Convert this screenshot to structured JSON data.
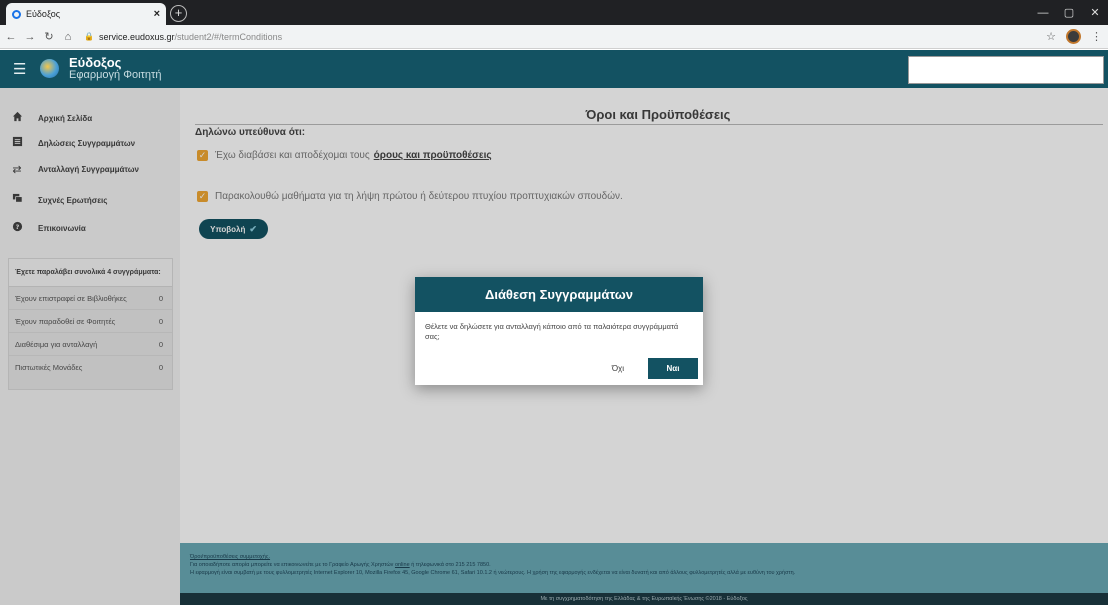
{
  "browser": {
    "tab_title": "Εύδοξος",
    "tab_close": "×",
    "new_tab": "+",
    "url_host": "service.eudoxus.gr",
    "url_path": "/student2/#/termConditions",
    "window_controls": [
      "—",
      "▢",
      "✕"
    ]
  },
  "header": {
    "title": "Εύδοξος",
    "subtitle": "Εφαρμογή Φοιτητή"
  },
  "sidebar": {
    "items": [
      {
        "label": "Αρχική Σελίδα",
        "icon": "home-icon"
      },
      {
        "label": "Δηλώσεις Συγγραμμάτων",
        "icon": "list-icon"
      },
      {
        "label": "Ανταλλαγή Συγγραμμάτων",
        "icon": "exchange-icon"
      },
      {
        "label": "Συχνές Ερωτήσεις",
        "icon": "chat-icon"
      },
      {
        "label": "Επικοινωνία",
        "icon": "help-icon"
      }
    ],
    "stats": {
      "title": "Έχετε παραλάβει συνολικά 4 συγγράμματα:",
      "rows": [
        {
          "label": "Έχουν επιστραφεί σε Βιβλιοθήκες",
          "value": "0"
        },
        {
          "label": "Έχουν παραδοθεί σε Φοιτητές",
          "value": "0"
        },
        {
          "label": "Διαθέσιμα για ανταλλαγή",
          "value": "0"
        },
        {
          "label": "Πιστωτικές Μονάδες",
          "value": "0"
        }
      ]
    }
  },
  "main": {
    "title": "Όροι και Προϋποθέσεις",
    "declare": "Δηλώνω υπεύθυνα ότι:",
    "check1_text": "Έχω διαβάσει και αποδέχομαι τους",
    "check1_link": "όρους και προϋποθέσεις",
    "check2_text": "Παρακολουθώ μαθήματα για τη λήψη πρώτου ή δεύτερου πτυχίου προπτυχιακών σπουδών.",
    "submit_label": "Υποβολή",
    "submit_icon": "✔"
  },
  "footer": {
    "link": "Όροι/προϋποθέσεις συμμετοχής.",
    "line1_pre": "Για οποιαδήποτε απορία μπορείτε να επικοινωνείτε με το Γραφείο Αρωγής Χρηστών",
    "line1_link": "online",
    "line1_post": "ή τηλεφωνικά στο 215 215 7850.",
    "line2": "Η εφαρμογή είναι συμβατή με τους φυλλομετρητές Internet Explorer 10, Mozilla Firefox 45, Google Chrome 61, Safari 10.1.2 ή νεώτερους. Η χρήση της εφαρμογής ενδέχεται να είναι δυνατή και από άλλους φυλλομετρητές αλλά με ευθύνη του χρήστη.",
    "bottom": "Με τη συγχρηματοδότηση της Ελλάδας & της Ευρωπαϊκής Ένωσης ©2018 - Εύδοξος"
  },
  "modal": {
    "title": "Διάθεση Συγγραμμάτων",
    "body": "Θέλετε να δηλώσετε για ανταλλαγή κάποιο από τα παλαιότερα συγγράμματά σας;",
    "no_label": "Όχι",
    "yes_label": "Ναι"
  },
  "colors": {
    "primary": "#135262",
    "accent": "#f1a833",
    "footer": "#6aaab6"
  }
}
